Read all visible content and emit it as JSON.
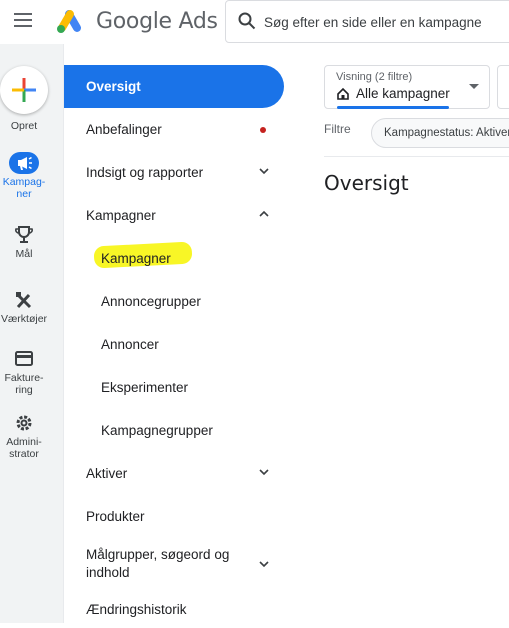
{
  "header": {
    "brand": "Google Ads",
    "search_placeholder": "Søg efter en side eller en kampagne"
  },
  "rail": {
    "create_label": "Opret",
    "items": [
      {
        "label": "Kampag-\nner",
        "icon": "megaphone-icon",
        "active": true
      },
      {
        "label": "Mål",
        "icon": "trophy-icon"
      },
      {
        "label": "Værktøjer",
        "icon": "tools-icon"
      },
      {
        "label": "Fakture-\nring",
        "icon": "credit-card-icon"
      },
      {
        "label": "Admini-\nstrator",
        "icon": "gear-icon"
      }
    ]
  },
  "nav": {
    "items": [
      {
        "label": "Oversigt",
        "active": true
      },
      {
        "label": "Anbefalinger",
        "badge": "red-dot"
      },
      {
        "label": "Indsigt og rapporter",
        "chevron": "down"
      },
      {
        "label": "Kampagner",
        "chevron": "up"
      },
      {
        "label": "Kampagner",
        "sub": true,
        "highlighted": true
      },
      {
        "label": "Annoncegrupper",
        "sub": true
      },
      {
        "label": "Annoncer",
        "sub": true
      },
      {
        "label": "Eksperimenter",
        "sub": true
      },
      {
        "label": "Kampagnegrupper",
        "sub": true
      },
      {
        "label": "Aktiver",
        "chevron": "down"
      },
      {
        "label": "Produkter"
      },
      {
        "label": "Målgrupper, søgeord og indhold",
        "chevron": "down"
      },
      {
        "label": "Ændringshistorik"
      }
    ]
  },
  "view": {
    "label": "Visning (2 filtre)",
    "value": "Alle kampagner"
  },
  "filters": {
    "label": "Filtre",
    "chip": "Kampagnestatus: Aktiver"
  },
  "main": {
    "title": "Oversigt"
  },
  "colors": {
    "accent": "#1a73e8",
    "highlight": "#f7f500",
    "badge": "#c5221f"
  }
}
